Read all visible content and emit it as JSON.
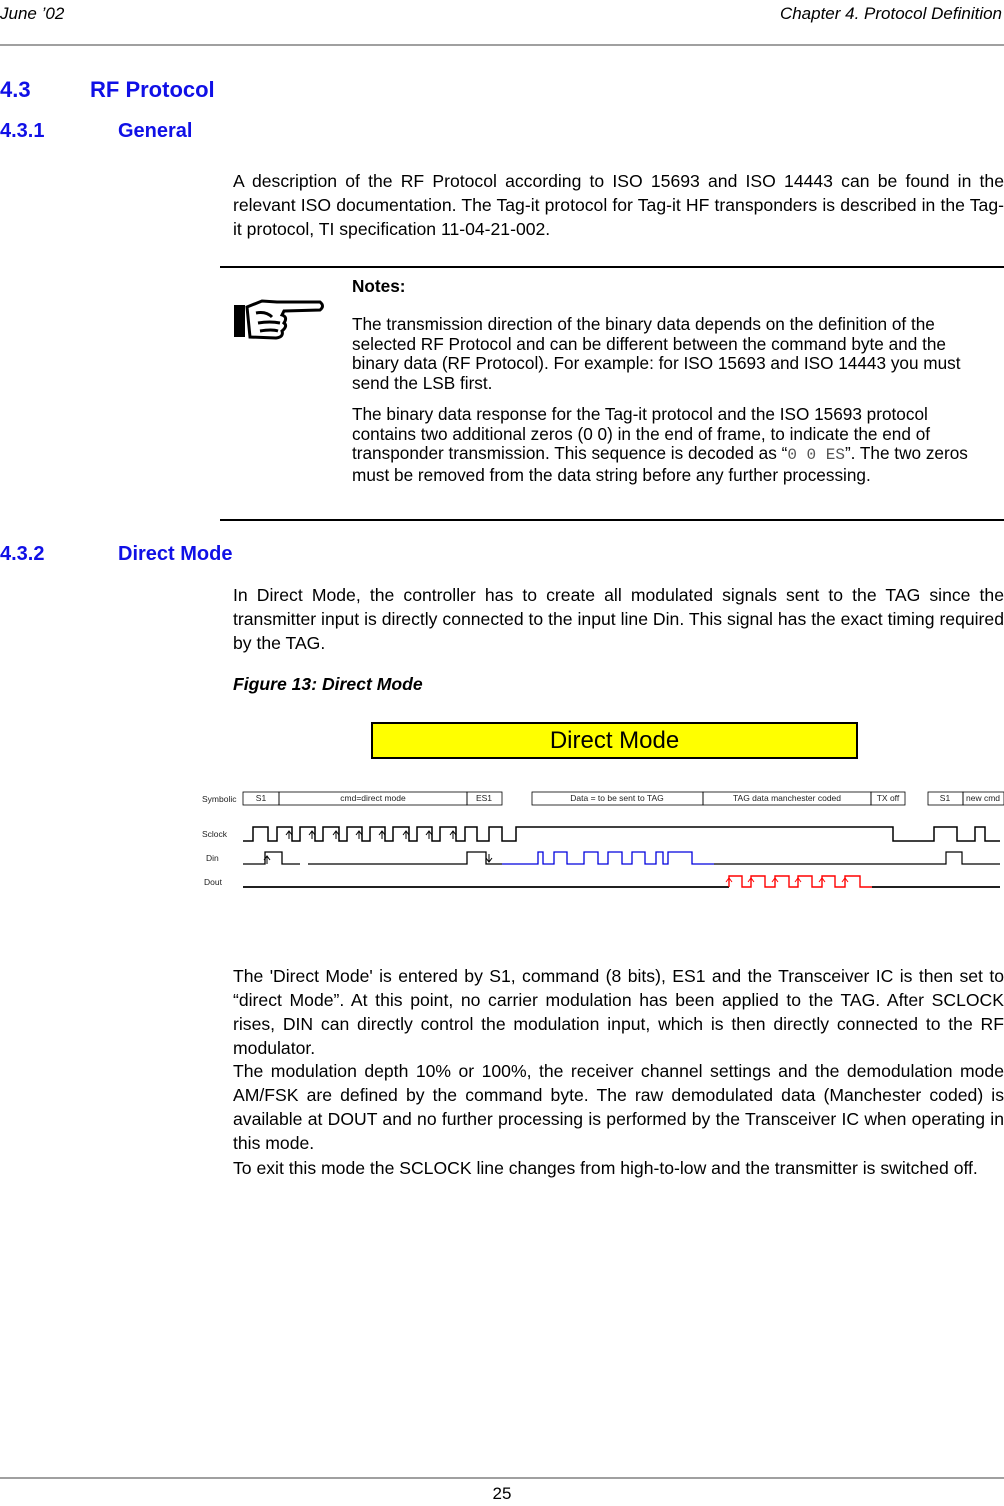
{
  "header": {
    "left": "June ’02",
    "right": "Chapter 4. Protocol Definition"
  },
  "section_4_3": {
    "number": "4.3",
    "title": "RF Protocol"
  },
  "section_4_3_1": {
    "number": "4.3.1",
    "title": "General",
    "paragraph": "A description of the RF Protocol according to ISO 15693 and ISO 14443 can be found in the relevant ISO documentation. The Tag-it protocol for Tag-it HF transponders is described in the Tag-it protocol, TI specification 11-04-21-002."
  },
  "notes": {
    "icon": "pointing-hand-icon",
    "title": "Notes:",
    "paragraph1": "The transmission direction of the binary data depends on the definition of the selected RF Protocol and can be different between the command byte and the binary data (RF Protocol). For example: for ISO 15693 and ISO 14443 you must send the LSB first.",
    "paragraph2_before": "The binary data response for the Tag-it protocol and the ISO 15693 protocol contains two additional zeros (0 0) in the end of frame, to indicate the end of transponder transmission. This sequence is decoded as “",
    "paragraph2_code": "0 0 ES",
    "paragraph2_after": "”. The two zeros must be removed from the data string before any further processing."
  },
  "section_4_3_2": {
    "number": "4.3.2",
    "title": "Direct Mode",
    "paragraph": "In Direct Mode, the controller has to create all modulated signals sent to the TAG since the transmitter input is directly connected to the input line Din. This signal has the exact timing required by the TAG."
  },
  "figure": {
    "caption": "Figure 13: Direct Mode",
    "banner": "Direct Mode",
    "banner_color": "#ffff00",
    "row_labels": {
      "symbolic": "Symbolic",
      "sclock": "Sclock",
      "din": "Din",
      "dout": "Dout"
    },
    "symbolic_segments": [
      "S1",
      "cmd=direct mode",
      "ES1",
      "Data = to be sent to TAG",
      "TAG data manchester coded",
      "TX off",
      "S1",
      "new cmd"
    ],
    "colors": {
      "din_data": "#0000dd",
      "dout_data": "#ff0000",
      "line": "#000000"
    }
  },
  "body": {
    "paragraph1": "The 'Direct Mode' is entered by S1, command (8 bits), ES1 and the Transceiver IC is then set to “direct Mode”. At this point, no carrier modulation has been applied to the TAG. After SCLOCK rises, DIN can directly control the modulation input, which is then directly connected to the RF modulator.",
    "paragraph2": "The modulation depth 10% or 100%, the receiver channel settings and the demodulation mode AM/FSK are defined by the command byte. The raw demodulated data (Manchester coded) is available at DOUT and no further processing is performed by the Transceiver IC when operating in this mode.",
    "paragraph3": "To exit this mode the SCLOCK line changes from high-to-low and the transmitter is switched off."
  },
  "footer": {
    "page_number": "25"
  }
}
